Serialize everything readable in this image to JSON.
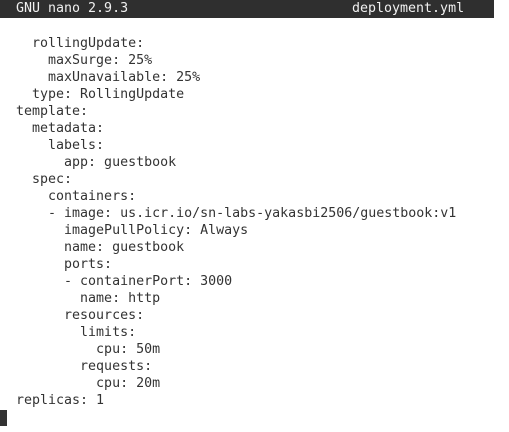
{
  "titlebar": {
    "app": "GNU nano 2.9.3",
    "filename": "deployment.yml"
  },
  "lines": [
    "  rollingUpdate:",
    "    maxSurge: 25%",
    "    maxUnavailable: 25%",
    "  type: RollingUpdate",
    "template:",
    "  metadata:",
    "    labels:",
    "      app: guestbook",
    "  spec:",
    "    containers:",
    "    - image: us.icr.io/sn-labs-yakasbi2506/guestbook:v1",
    "      imagePullPolicy: Always",
    "      name: guestbook",
    "      ports:",
    "      - containerPort: 3000",
    "        name: http",
    "      resources:",
    "        limits:",
    "          cpu: 50m",
    "        requests:",
    "          cpu: 20m",
    "replicas: 1"
  ]
}
